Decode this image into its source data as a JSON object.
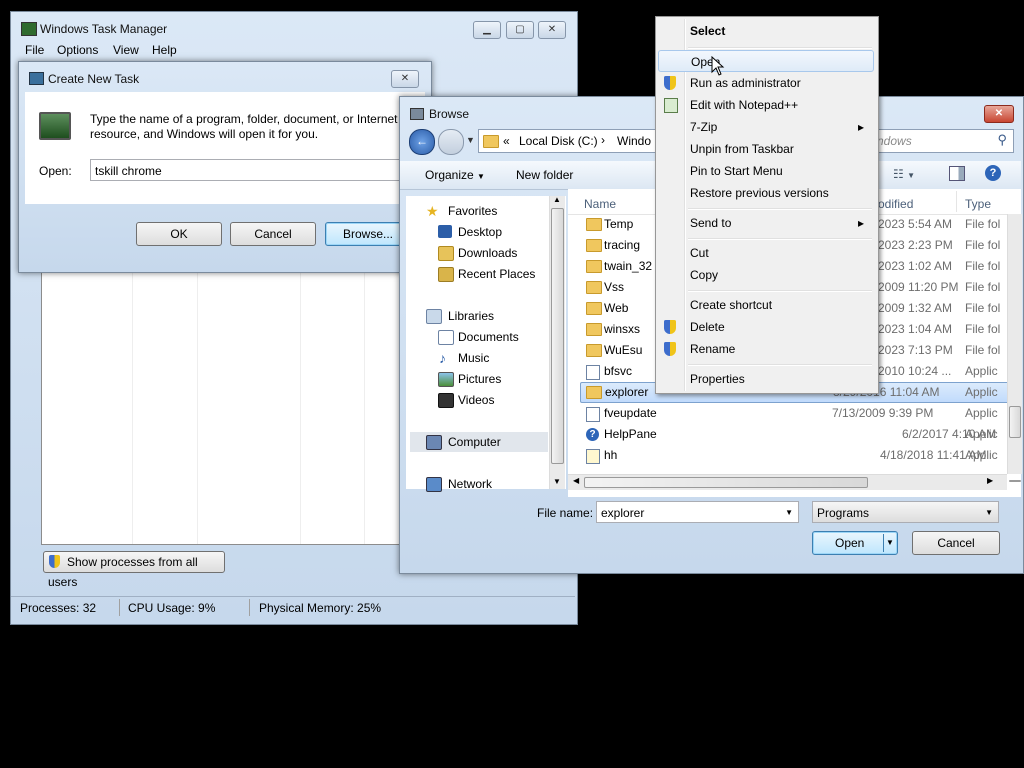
{
  "task_manager": {
    "title": "Windows Task Manager",
    "menu": [
      "File",
      "Options",
      "View",
      "Help"
    ],
    "show_processes_label": "Show processes from all users",
    "status": {
      "processes": "Processes: 32",
      "cpu": "CPU Usage: 9%",
      "memory": "Physical Memory: 25%"
    }
  },
  "create_task": {
    "title": "Create New Task",
    "description": "Type the name of a program, folder, document, or Internet resource, and Windows will open it for you.",
    "open_label": "Open:",
    "open_value": "tskill chrome",
    "ok": "OK",
    "cancel": "Cancel",
    "browse": "Browse..."
  },
  "browse": {
    "title": "Browse",
    "breadcrumb": [
      "«",
      "Local Disk (C:)",
      "Windo"
    ],
    "search_placeholder": "ndows",
    "toolbar": {
      "organize": "Organize",
      "new_folder": "New folder"
    },
    "nav": {
      "favorites": "Favorites",
      "desktop": "Desktop",
      "downloads": "Downloads",
      "recent": "Recent Places",
      "libraries": "Libraries",
      "documents": "Documents",
      "music": "Music",
      "pictures": "Pictures",
      "videos": "Videos",
      "computer": "Computer",
      "network": "Network"
    },
    "columns": {
      "name": "Name",
      "modified": "odified",
      "type": "Type"
    },
    "rows": [
      {
        "name": "Temp",
        "date": "2023 5:54 AM",
        "type": "File fol",
        "icon": "folder"
      },
      {
        "name": "tracing",
        "date": "2023 2:23 PM",
        "type": "File fol",
        "icon": "folder"
      },
      {
        "name": "twain_32",
        "date": "2023 1:02 AM",
        "type": "File fol",
        "icon": "folder"
      },
      {
        "name": "Vss",
        "date": "2009 11:20 PM",
        "type": "File fol",
        "icon": "folder"
      },
      {
        "name": "Web",
        "date": "2009 1:32 AM",
        "type": "File fol",
        "icon": "folder"
      },
      {
        "name": "winsxs",
        "date": "2023 1:04 AM",
        "type": "File fol",
        "icon": "folder"
      },
      {
        "name": "WuEsu",
        "date": "2023 7:13 PM",
        "type": "File fol",
        "icon": "folder"
      },
      {
        "name": "bfsvc",
        "date": "2010 10:24 ...",
        "type": "Applic",
        "icon": "app"
      },
      {
        "name": "explorer",
        "date": "8/29/2016 11:04 AM",
        "type": "Applic",
        "icon": "explorer"
      },
      {
        "name": "fveupdate",
        "date": "7/13/2009 9:39 PM",
        "type": "Applic",
        "icon": "app"
      },
      {
        "name": "HelpPane",
        "date": "6/2/2017 4:10 AM",
        "type": "Applic",
        "icon": "help"
      },
      {
        "name": "hh",
        "date": "4/18/2018 11:41 AM",
        "type": "Applic",
        "icon": "help-doc"
      }
    ],
    "filename_label": "File name:",
    "filename_value": "explorer",
    "filetype_value": "Programs",
    "open": "Open",
    "cancel": "Cancel"
  },
  "context_menu": {
    "items": [
      {
        "label": "Select",
        "bold": true
      },
      {
        "label": "Open",
        "highlighted": true
      },
      {
        "label": "Run as administrator",
        "shield": true
      },
      {
        "label": "Edit with Notepad++",
        "icon": "notepad"
      },
      {
        "label": "7-Zip",
        "submenu": true
      },
      {
        "label": "Unpin from Taskbar"
      },
      {
        "label": "Pin to Start Menu"
      },
      {
        "label": "Restore previous versions"
      },
      {
        "label": "Send to",
        "submenu": true
      },
      {
        "label": "Cut"
      },
      {
        "label": "Copy"
      },
      {
        "label": "Create shortcut"
      },
      {
        "label": "Delete",
        "shield": true
      },
      {
        "label": "Rename",
        "shield": true
      },
      {
        "label": "Properties"
      }
    ],
    "submenu_arrow": "▸"
  }
}
